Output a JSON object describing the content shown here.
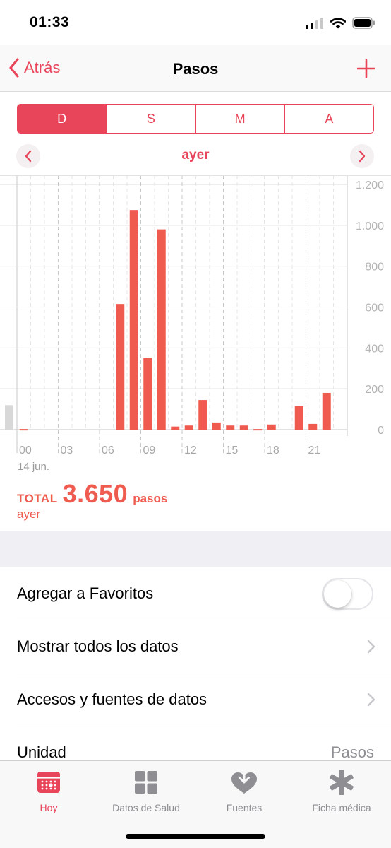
{
  "status_bar": {
    "time": "01:33"
  },
  "nav": {
    "back_label": "Atrás",
    "title": "Pasos"
  },
  "segments": [
    {
      "label": "D",
      "active": true
    },
    {
      "label": "S",
      "active": false
    },
    {
      "label": "M",
      "active": false
    },
    {
      "label": "A",
      "active": false
    }
  ],
  "date_nav": {
    "label": "ayer"
  },
  "chart_data": {
    "type": "bar",
    "x_tick_labels": [
      "00",
      "03",
      "06",
      "09",
      "12",
      "15",
      "18",
      "21"
    ],
    "y_tick_labels": [
      "1.200",
      "1.000",
      "800",
      "600",
      "400",
      "200",
      "0"
    ],
    "ylim": [
      0,
      1200
    ],
    "grid": true,
    "hours": [
      0,
      1,
      2,
      3,
      4,
      5,
      6,
      7,
      8,
      9,
      10,
      11,
      12,
      13,
      14,
      15,
      16,
      17,
      18,
      19,
      20,
      21,
      22,
      23
    ],
    "values": [
      3,
      0,
      0,
      0,
      0,
      0,
      0,
      615,
      1075,
      350,
      980,
      15,
      20,
      145,
      35,
      20,
      20,
      3,
      25,
      0,
      115,
      28,
      180,
      0
    ],
    "previous_day_partial_value": 120,
    "bar_color": "#ef5b4f",
    "date_label": "14 jun."
  },
  "summary": {
    "total_label": "TOTAL",
    "total_value": "3.650",
    "unit": "pasos",
    "period": "ayer"
  },
  "settings": {
    "favorites_label": "Agregar a Favoritos",
    "favorites_on": false,
    "show_all_label": "Mostrar todos los datos",
    "sources_label": "Accesos y fuentes de datos",
    "unit_label": "Unidad",
    "unit_value": "Pasos"
  },
  "tabs": [
    {
      "label": "Hoy",
      "icon": "calendar-icon",
      "active": true
    },
    {
      "label": "Datos de Salud",
      "icon": "grid-icon",
      "active": false
    },
    {
      "label": "Fuentes",
      "icon": "heart-arrow-icon",
      "active": false
    },
    {
      "label": "Ficha médica",
      "icon": "asterisk-icon",
      "active": false
    }
  ],
  "colors": {
    "accent": "#e8445a",
    "bar": "#ef5b4f"
  }
}
